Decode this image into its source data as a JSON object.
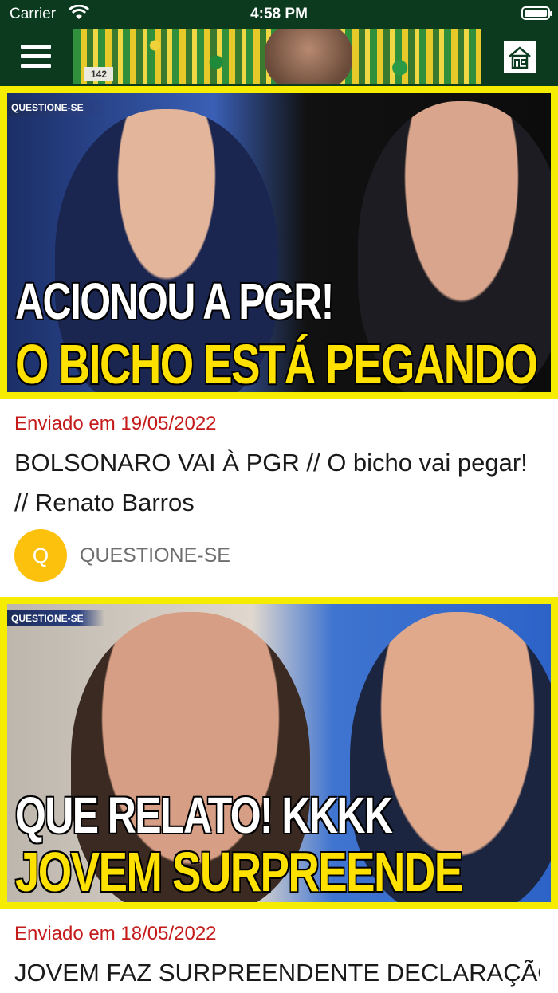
{
  "status_bar": {
    "carrier": "Carrier",
    "time": "4:58 PM"
  },
  "nav": {
    "menu_icon": "hamburger-menu-icon",
    "home_icon": "home-icon",
    "banner_sign": "142"
  },
  "colors": {
    "nav_background": "#0b3a1f",
    "thumbnail_border": "#f5ec00",
    "date_text": "#c41a1a",
    "avatar": "#fbc10d"
  },
  "posts": [
    {
      "thumbnail": {
        "channel_tag": "QUESTIONE-SE",
        "headline_white": "ACIONOU A PGR!",
        "headline_yellow": "O BICHO ESTÁ PEGANDO"
      },
      "date": "Enviado em 19/05/2022",
      "title": "BOLSONARO VAI À PGR // O bicho vai pegar! // Renato Barros",
      "avatar_letter": "Q",
      "author": "QUESTIONE-SE"
    },
    {
      "thumbnail": {
        "channel_tag": "QUESTIONE-SE",
        "headline_white": "QUE RELATO! KKKK",
        "headline_yellow": "JOVEM SURPREENDE"
      },
      "date": "Enviado em 18/05/2022",
      "title": "JOVEM FAZ SURPREENDENTE DECLARAÇÃO"
    }
  ]
}
